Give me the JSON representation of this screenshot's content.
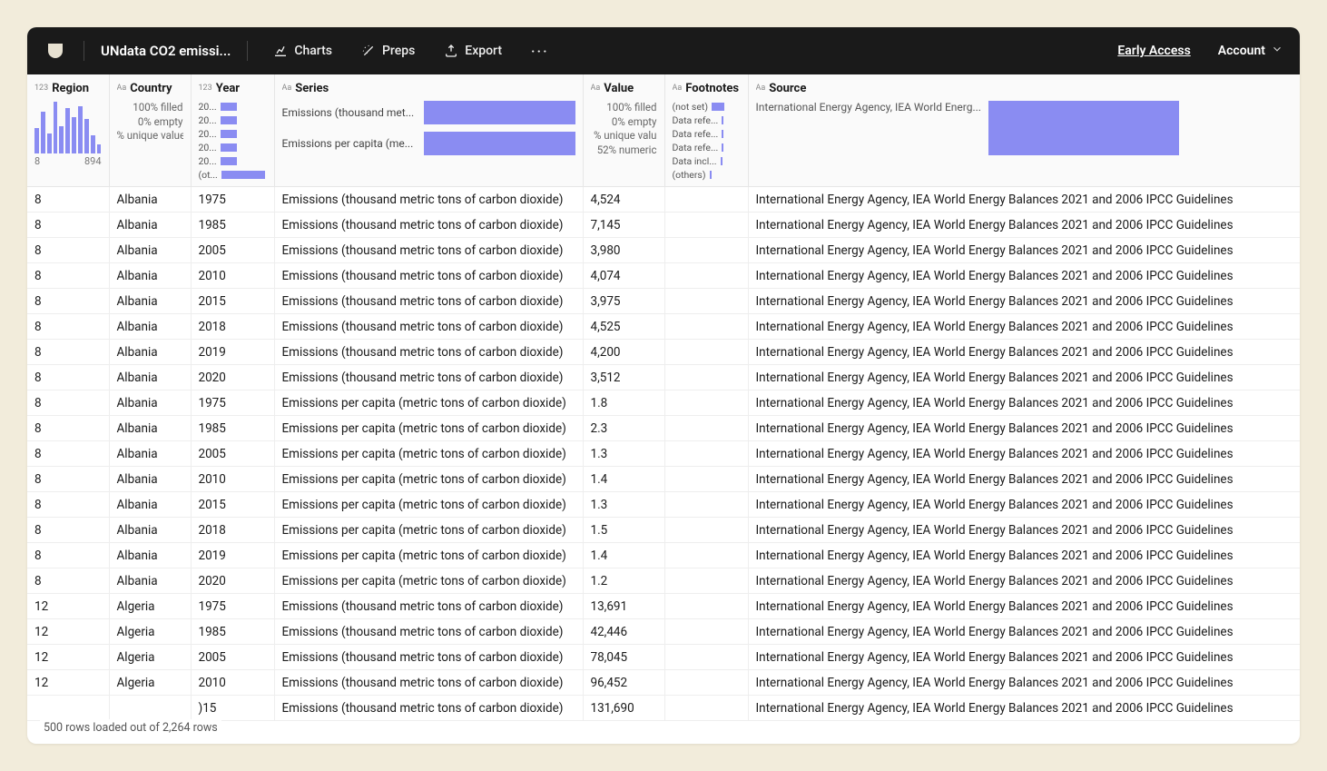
{
  "topbar": {
    "title": "UNdata CO2 emissi...",
    "charts": "Charts",
    "preps": "Preps",
    "export": "Export",
    "early_access": "Early Access",
    "account": "Account"
  },
  "columns": {
    "region": {
      "name": "Region",
      "type_label": "123",
      "range_min": "8",
      "range_max": "894",
      "histogram_heights": [
        28,
        46,
        22,
        57,
        30,
        50,
        40,
        52,
        38,
        20,
        10
      ]
    },
    "country": {
      "name": "Country",
      "type_label": "Aa",
      "stats": [
        "100% filled",
        "0% empty",
        "% unique value"
      ]
    },
    "year": {
      "name": "Year",
      "type_label": "123",
      "cats": [
        {
          "label": "20...",
          "w": 18
        },
        {
          "label": "20...",
          "w": 18
        },
        {
          "label": "20...",
          "w": 18
        },
        {
          "label": "20...",
          "w": 18
        },
        {
          "label": "20...",
          "w": 18
        },
        {
          "label": "(ot...",
          "w": 48
        }
      ]
    },
    "series": {
      "name": "Series",
      "type_label": "Aa",
      "cats": [
        {
          "label": "Emissions (thousand met..."
        },
        {
          "label": "Emissions per capita (me..."
        }
      ]
    },
    "value": {
      "name": "Value",
      "type_label": "Aa",
      "stats": [
        "100% filled",
        "0% empty",
        "% unique valu",
        "52% numeric"
      ]
    },
    "footnotes": {
      "name": "Footnotes",
      "type_label": "Aa",
      "cats": [
        {
          "label": "(not set)",
          "w": 14
        },
        {
          "label": "Data refe...",
          "w": 2
        },
        {
          "label": "Data refe...",
          "w": 2
        },
        {
          "label": "Data refe...",
          "w": 2
        },
        {
          "label": "Data incl...",
          "w": 2
        },
        {
          "label": "(others)",
          "w": 2
        }
      ]
    },
    "source": {
      "name": "Source",
      "type_label": "Aa",
      "summary": "International Energy Agency, IEA World Energ..."
    }
  },
  "rows": [
    {
      "region": "8",
      "country": "Albania",
      "year": "1975",
      "series": "Emissions (thousand metric tons of carbon dioxide)",
      "value": "4,524",
      "footnotes": "",
      "source": "International Energy Agency, IEA World Energy Balances 2021 and 2006 IPCC Guidelines"
    },
    {
      "region": "8",
      "country": "Albania",
      "year": "1985",
      "series": "Emissions (thousand metric tons of carbon dioxide)",
      "value": "7,145",
      "footnotes": "",
      "source": "International Energy Agency, IEA World Energy Balances 2021 and 2006 IPCC Guidelines"
    },
    {
      "region": "8",
      "country": "Albania",
      "year": "2005",
      "series": "Emissions (thousand metric tons of carbon dioxide)",
      "value": "3,980",
      "footnotes": "",
      "source": "International Energy Agency, IEA World Energy Balances 2021 and 2006 IPCC Guidelines"
    },
    {
      "region": "8",
      "country": "Albania",
      "year": "2010",
      "series": "Emissions (thousand metric tons of carbon dioxide)",
      "value": "4,074",
      "footnotes": "",
      "source": "International Energy Agency, IEA World Energy Balances 2021 and 2006 IPCC Guidelines"
    },
    {
      "region": "8",
      "country": "Albania",
      "year": "2015",
      "series": "Emissions (thousand metric tons of carbon dioxide)",
      "value": "3,975",
      "footnotes": "",
      "source": "International Energy Agency, IEA World Energy Balances 2021 and 2006 IPCC Guidelines"
    },
    {
      "region": "8",
      "country": "Albania",
      "year": "2018",
      "series": "Emissions (thousand metric tons of carbon dioxide)",
      "value": "4,525",
      "footnotes": "",
      "source": "International Energy Agency, IEA World Energy Balances 2021 and 2006 IPCC Guidelines"
    },
    {
      "region": "8",
      "country": "Albania",
      "year": "2019",
      "series": "Emissions (thousand metric tons of carbon dioxide)",
      "value": "4,200",
      "footnotes": "",
      "source": "International Energy Agency, IEA World Energy Balances 2021 and 2006 IPCC Guidelines"
    },
    {
      "region": "8",
      "country": "Albania",
      "year": "2020",
      "series": "Emissions (thousand metric tons of carbon dioxide)",
      "value": "3,512",
      "footnotes": "",
      "source": "International Energy Agency, IEA World Energy Balances 2021 and 2006 IPCC Guidelines"
    },
    {
      "region": "8",
      "country": "Albania",
      "year": "1975",
      "series": "Emissions per capita (metric tons of carbon dioxide)",
      "value": "1.8",
      "footnotes": "",
      "source": "International Energy Agency, IEA World Energy Balances 2021 and 2006 IPCC Guidelines"
    },
    {
      "region": "8",
      "country": "Albania",
      "year": "1985",
      "series": "Emissions per capita (metric tons of carbon dioxide)",
      "value": "2.3",
      "footnotes": "",
      "source": "International Energy Agency, IEA World Energy Balances 2021 and 2006 IPCC Guidelines"
    },
    {
      "region": "8",
      "country": "Albania",
      "year": "2005",
      "series": "Emissions per capita (metric tons of carbon dioxide)",
      "value": "1.3",
      "footnotes": "",
      "source": "International Energy Agency, IEA World Energy Balances 2021 and 2006 IPCC Guidelines"
    },
    {
      "region": "8",
      "country": "Albania",
      "year": "2010",
      "series": "Emissions per capita (metric tons of carbon dioxide)",
      "value": "1.4",
      "footnotes": "",
      "source": "International Energy Agency, IEA World Energy Balances 2021 and 2006 IPCC Guidelines"
    },
    {
      "region": "8",
      "country": "Albania",
      "year": "2015",
      "series": "Emissions per capita (metric tons of carbon dioxide)",
      "value": "1.3",
      "footnotes": "",
      "source": "International Energy Agency, IEA World Energy Balances 2021 and 2006 IPCC Guidelines"
    },
    {
      "region": "8",
      "country": "Albania",
      "year": "2018",
      "series": "Emissions per capita (metric tons of carbon dioxide)",
      "value": "1.5",
      "footnotes": "",
      "source": "International Energy Agency, IEA World Energy Balances 2021 and 2006 IPCC Guidelines"
    },
    {
      "region": "8",
      "country": "Albania",
      "year": "2019",
      "series": "Emissions per capita (metric tons of carbon dioxide)",
      "value": "1.4",
      "footnotes": "",
      "source": "International Energy Agency, IEA World Energy Balances 2021 and 2006 IPCC Guidelines"
    },
    {
      "region": "8",
      "country": "Albania",
      "year": "2020",
      "series": "Emissions per capita (metric tons of carbon dioxide)",
      "value": "1.2",
      "footnotes": "",
      "source": "International Energy Agency, IEA World Energy Balances 2021 and 2006 IPCC Guidelines"
    },
    {
      "region": "12",
      "country": "Algeria",
      "year": "1975",
      "series": "Emissions (thousand metric tons of carbon dioxide)",
      "value": "13,691",
      "footnotes": "",
      "source": "International Energy Agency, IEA World Energy Balances 2021 and 2006 IPCC Guidelines"
    },
    {
      "region": "12",
      "country": "Algeria",
      "year": "1985",
      "series": "Emissions (thousand metric tons of carbon dioxide)",
      "value": "42,446",
      "footnotes": "",
      "source": "International Energy Agency, IEA World Energy Balances 2021 and 2006 IPCC Guidelines"
    },
    {
      "region": "12",
      "country": "Algeria",
      "year": "2005",
      "series": "Emissions (thousand metric tons of carbon dioxide)",
      "value": "78,045",
      "footnotes": "",
      "source": "International Energy Agency, IEA World Energy Balances 2021 and 2006 IPCC Guidelines"
    },
    {
      "region": "12",
      "country": "Algeria",
      "year": "2010",
      "series": "Emissions (thousand metric tons of carbon dioxide)",
      "value": "96,452",
      "footnotes": "",
      "source": "International Energy Agency, IEA World Energy Balances 2021 and 2006 IPCC Guidelines"
    },
    {
      "region": "",
      "country": "",
      "year": ")15",
      "series": "Emissions (thousand metric tons of carbon dioxide)",
      "value": "131,690",
      "footnotes": "",
      "source": "International Energy Agency, IEA World Energy Balances 2021 and 2006 IPCC Guidelines"
    }
  ],
  "status": "500 rows loaded out of 2,264 rows"
}
